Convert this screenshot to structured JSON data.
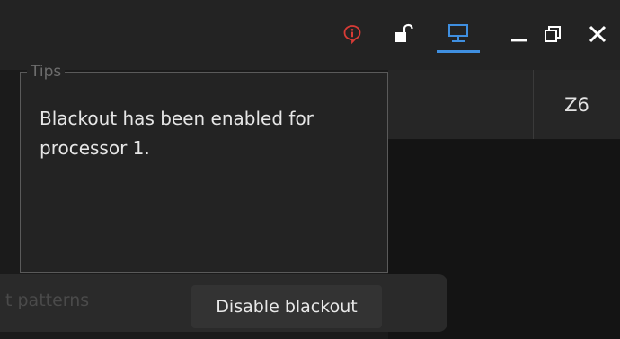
{
  "titlebar": {
    "icons": {
      "alert": "info-alert-icon",
      "lock": "unlock-icon",
      "monitor": "monitor-icon",
      "minimize": "minimize-icon",
      "restore": "restore-icon",
      "close": "close-icon"
    },
    "colors": {
      "alert": "#d83b36",
      "accent": "#3f8fe0",
      "icon": "#ffffff"
    }
  },
  "table": {
    "header_visible": "Z6"
  },
  "background": {
    "partial_label": "t patterns"
  },
  "tips": {
    "legend": "Tips",
    "message": "Blackout has been enabled for processor 1.",
    "action_label": "Disable blackout"
  }
}
